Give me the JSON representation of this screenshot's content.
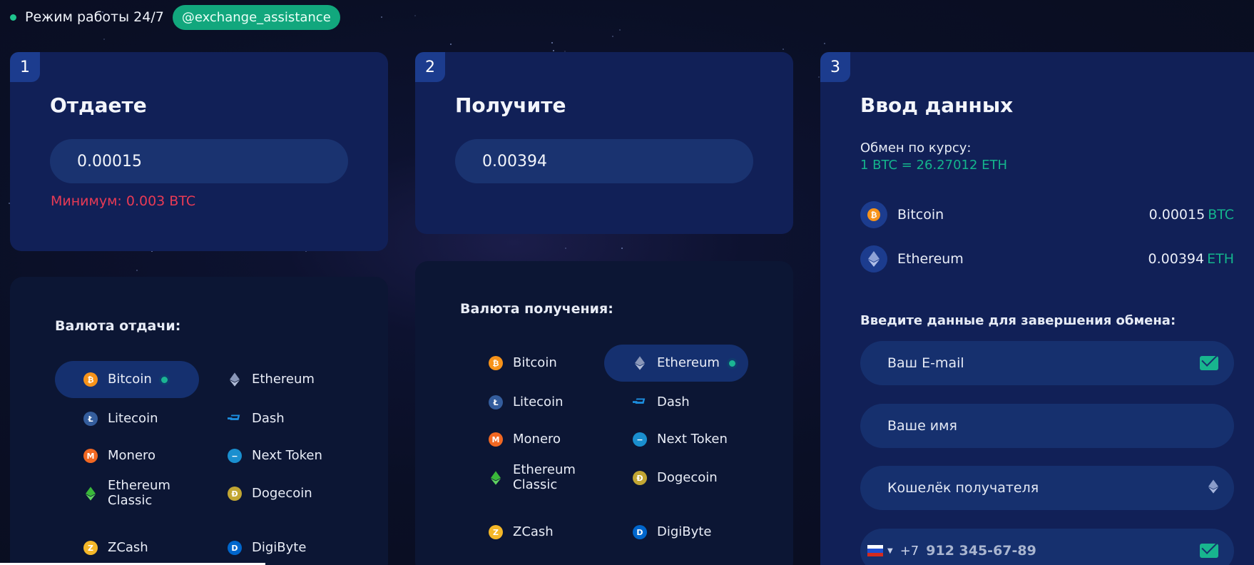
{
  "topbar": {
    "mode": "Режим работы 24/7",
    "telegram": "@exchange_assistance"
  },
  "give": {
    "step": "1",
    "title": "Отдаете",
    "amount": "0.00015",
    "min_warning": "Минимум: 0.003 BTC",
    "list_label": "Валюта отдачи:",
    "selected": "Bitcoin",
    "currencies": [
      {
        "name": "Bitcoin",
        "icon": "bitcoin-icon"
      },
      {
        "name": "Ethereum",
        "icon": "ethereum-icon"
      },
      {
        "name": "Litecoin",
        "icon": "litecoin-icon"
      },
      {
        "name": "Dash",
        "icon": "dash-icon"
      },
      {
        "name": "Monero",
        "icon": "monero-icon"
      },
      {
        "name": "Next Token",
        "icon": "next-token-icon"
      },
      {
        "name": "Ethereum Classic",
        "icon": "ethereum-classic-icon"
      },
      {
        "name": "Dogecoin",
        "icon": "dogecoin-icon"
      },
      {
        "name": "ZCash",
        "icon": "zcash-icon"
      },
      {
        "name": "DigiByte",
        "icon": "digibyte-icon"
      }
    ]
  },
  "receive": {
    "step": "2",
    "title": "Получите",
    "amount": "0.00394",
    "list_label": "Валюта получения:",
    "selected": "Ethereum",
    "currencies": [
      {
        "name": "Bitcoin",
        "icon": "bitcoin-icon"
      },
      {
        "name": "Ethereum",
        "icon": "ethereum-icon"
      },
      {
        "name": "Litecoin",
        "icon": "litecoin-icon"
      },
      {
        "name": "Dash",
        "icon": "dash-icon"
      },
      {
        "name": "Monero",
        "icon": "monero-icon"
      },
      {
        "name": "Next Token",
        "icon": "next-token-icon"
      },
      {
        "name": "Ethereum Classic",
        "icon": "ethereum-classic-icon"
      },
      {
        "name": "Dogecoin",
        "icon": "dogecoin-icon"
      },
      {
        "name": "ZCash",
        "icon": "zcash-icon"
      },
      {
        "name": "DigiByte",
        "icon": "digibyte-icon"
      }
    ]
  },
  "details": {
    "step": "3",
    "title": "Ввод данных",
    "rate_label": "Обмен по курсу:",
    "rate_value": "1 BTC = 26.27012 ETH",
    "summary": [
      {
        "name": "Bitcoin",
        "amount": "0.00015",
        "unit": "BTC",
        "icon": "bitcoin-icon"
      },
      {
        "name": "Ethereum",
        "amount": "0.00394",
        "unit": "ETH",
        "icon": "ethereum-icon"
      }
    ],
    "enter_label": "Введите данные для завершения обмена:",
    "email_placeholder": "Ваш E-mail",
    "name_placeholder": "Ваше имя",
    "wallet_placeholder": "Кошелёк получателя",
    "phone_prefix": "+7",
    "phone_placeholder": "912 345-67-89"
  },
  "colors": {
    "accent": "#14b58c",
    "panel": "#112057",
    "warning": "#e83a55"
  }
}
